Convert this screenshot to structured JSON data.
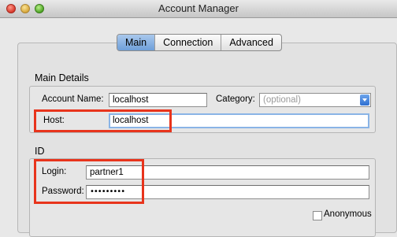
{
  "window": {
    "title": "Account Manager"
  },
  "tabs": [
    {
      "label": "Main",
      "active": true
    },
    {
      "label": "Connection",
      "active": false
    },
    {
      "label": "Advanced",
      "active": false
    }
  ],
  "main_details": {
    "title": "Main Details",
    "account_name_label": "Account Name:",
    "account_name_value": "localhost",
    "category_label": "Category:",
    "category_placeholder": "(optional)",
    "host_label": "Host:",
    "host_value": "localhost"
  },
  "id_section": {
    "title": "ID",
    "login_label": "Login:",
    "login_value": "partner1",
    "password_label": "Password:",
    "password_value": "•••••••••",
    "anonymous_label": "Anonymous",
    "anonymous_checked": false
  },
  "colors": {
    "highlight": "#e8341c",
    "accent": "#6e9fd9"
  }
}
